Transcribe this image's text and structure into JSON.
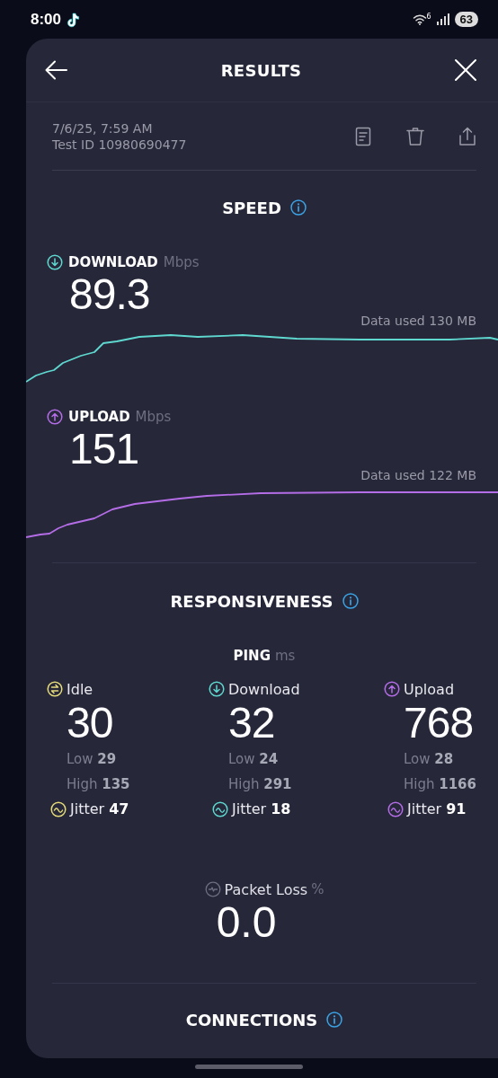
{
  "status_bar": {
    "time": "8:00",
    "wifi_generation": "6",
    "battery": "63"
  },
  "header": {
    "title": "RESULTS"
  },
  "test": {
    "date": "7/6/25, 7:59 AM",
    "test_id": "Test ID 10980690477"
  },
  "speed": {
    "title": "SPEED",
    "results": [
      {
        "kind": "download",
        "label": "DOWNLOAD",
        "unit": "Mbps",
        "value": "89.3",
        "data_used": "Data used 130 MB",
        "color": "#5fd8d0"
      },
      {
        "kind": "upload",
        "label": "UPLOAD",
        "unit": "Mbps",
        "value": "151",
        "data_used": "Data used 122 MB",
        "color": "#b46de6"
      }
    ]
  },
  "responsiveness": {
    "title": "RESPONSIVENESS",
    "ping": {
      "label": "PING",
      "unit": "ms",
      "columns": [
        {
          "kind": "idle",
          "label": "Idle",
          "value": "30",
          "low": "Low **29**",
          "high": "High **135**",
          "jitter": "Jitter **47**",
          "color": "#e6dc7a"
        },
        {
          "kind": "download",
          "label": "Download",
          "value": "32",
          "low": "Low **24**",
          "high": "High **291**",
          "jitter": "Jitter **18**",
          "color": "#5fd8d0"
        },
        {
          "kind": "upload",
          "label": "Upload",
          "value": "768",
          "low": "Low **28**",
          "high": "High **1166**",
          "jitter": "Jitter **91**",
          "color": "#b46de6"
        }
      ]
    },
    "packet_loss": {
      "label": "Packet Loss",
      "unit": "%",
      "value": "0.0"
    }
  },
  "connections": {
    "title": "CONNECTIONS"
  }
}
